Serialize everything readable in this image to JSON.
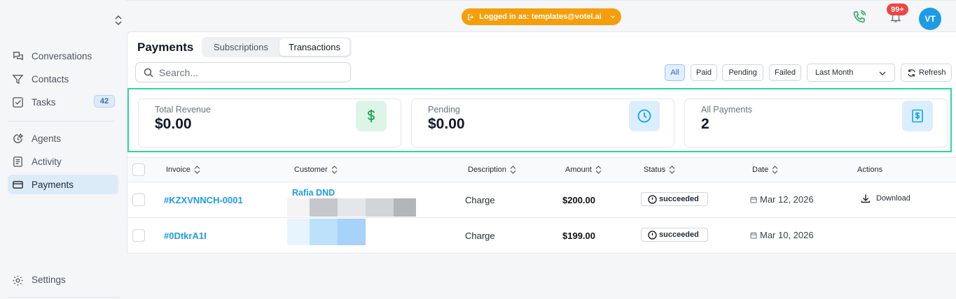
{
  "topbar": {
    "login_text": "Logged in as: templates@votel.ai",
    "notif_count": "99+",
    "avatar_initials": "VT"
  },
  "sidebar": {
    "items": [
      {
        "label": "Conversations",
        "icon": "chat-icon"
      },
      {
        "label": "Contacts",
        "icon": "filter-icon"
      },
      {
        "label": "Tasks",
        "icon": "task-check-icon",
        "badge": "42"
      },
      {
        "label": "Agents",
        "icon": "agent-icon"
      },
      {
        "label": "Activity",
        "icon": "activity-list-icon"
      },
      {
        "label": "Payments",
        "icon": "card-icon",
        "active": true
      }
    ],
    "settings_label": "Settings"
  },
  "page": {
    "title": "Payments",
    "tabs": [
      "Subscriptions",
      "Transactions"
    ],
    "active_tab": "Transactions"
  },
  "search": {
    "placeholder": "Search...",
    "value": ""
  },
  "filters": {
    "buttons": [
      "All",
      "Paid",
      "Pending",
      "Failed"
    ],
    "active": "All",
    "period": "Last Month",
    "refresh_label": "Refresh"
  },
  "stats": [
    {
      "label": "Total Revenue",
      "value": "$0.00",
      "icon": "dollar-icon"
    },
    {
      "label": "Pending",
      "value": "$0.00",
      "icon": "clock-icon"
    },
    {
      "label": "All Payments",
      "value": "2",
      "icon": "receipt-icon"
    }
  ],
  "table": {
    "columns": [
      "Invoice",
      "Customer",
      "Description",
      "Amount",
      "Status",
      "Date",
      "Actions"
    ],
    "rows": [
      {
        "invoice": "#KZXVNNCH-0001",
        "customer": "Rafia DND",
        "description": "Charge",
        "amount": "$200.00",
        "status": "succeeded",
        "date": "Mar 12, 2026",
        "action": "Download"
      },
      {
        "invoice": "#0DtkrA1I",
        "customer": "",
        "description": "Charge",
        "amount": "$199.00",
        "status": "succeeded",
        "date": "Mar 10, 2026",
        "action": ""
      }
    ]
  },
  "colors": {
    "accent": "#1e9be8",
    "login_pill": "#f59e0b",
    "stats_highlight": "#2dd4a8",
    "notification": "#ef4444"
  }
}
